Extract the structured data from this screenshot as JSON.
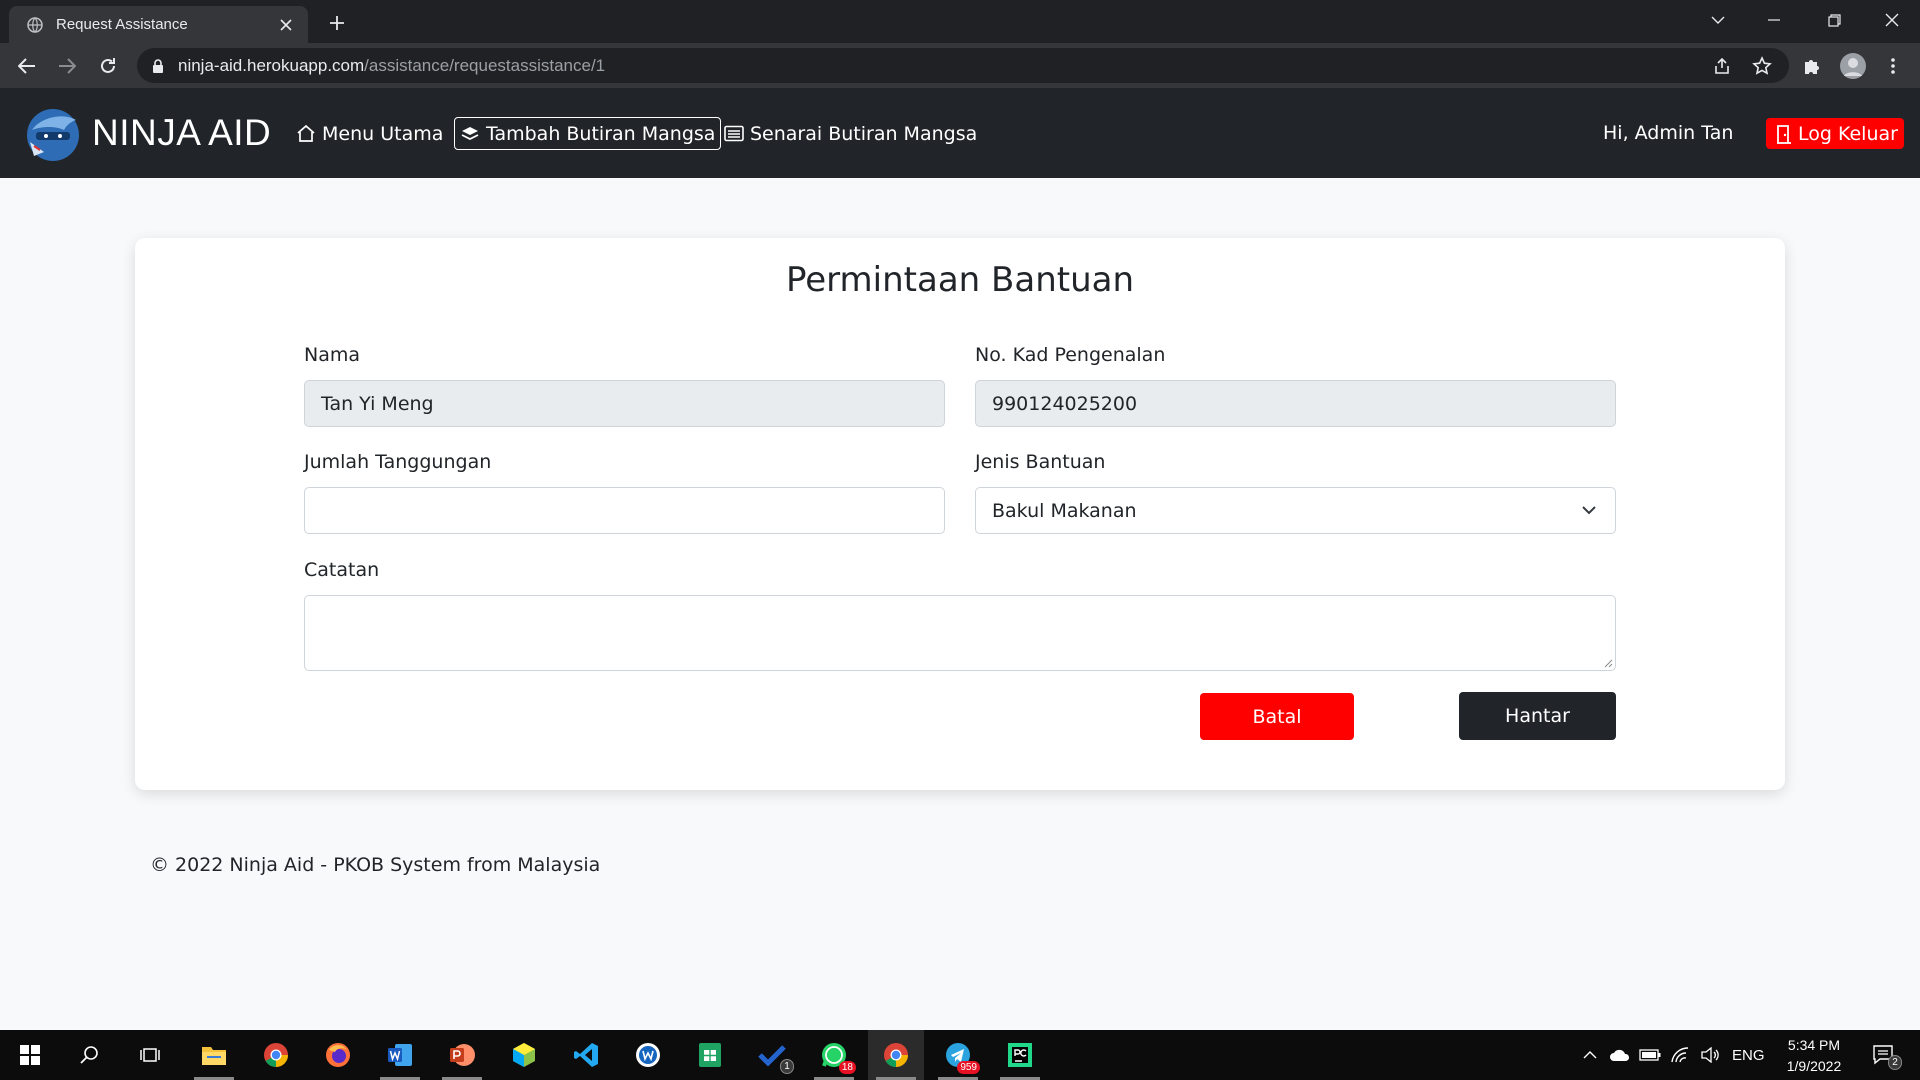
{
  "browser": {
    "tab_title": "Request Assistance",
    "url_host": "ninja-aid.herokuapp.com",
    "url_path": "/assistance/requestassistance/1"
  },
  "navbar": {
    "brand": "NINJA AID",
    "links": [
      {
        "label": "Menu Utama",
        "icon": "home-icon"
      },
      {
        "label": "Tambah Butiran Mangsa",
        "icon": "layers-icon",
        "active": true
      },
      {
        "label": "Senarai Butiran Mangsa",
        "icon": "list-card-icon"
      }
    ],
    "greeting": "Hi, Admin Tan",
    "logout": "Log Keluar",
    "logout_color": "#ff0000"
  },
  "form": {
    "title": "Permintaan Bantuan",
    "name_label": "Nama",
    "name_value": "Tan Yi Meng",
    "ic_label": "No. Kad Pengenalan",
    "ic_value": "990124025200",
    "dependents_label": "Jumlah Tanggungan",
    "dependents_value": "",
    "aid_type_label": "Jenis Bantuan",
    "aid_type_value": "Bakul Makanan",
    "notes_label": "Catatan",
    "notes_value": "",
    "cancel_label": "Batal",
    "submit_label": "Hantar"
  },
  "footer": {
    "text": "© 2022 Ninja Aid - PKOB System from Malaysia"
  },
  "taskbar": {
    "badges": {
      "todo": "1",
      "whatsapp": "18",
      "telegram": "959"
    },
    "language": "ENG",
    "time": "5:34 PM",
    "date": "1/9/2022",
    "notifications": "2"
  }
}
